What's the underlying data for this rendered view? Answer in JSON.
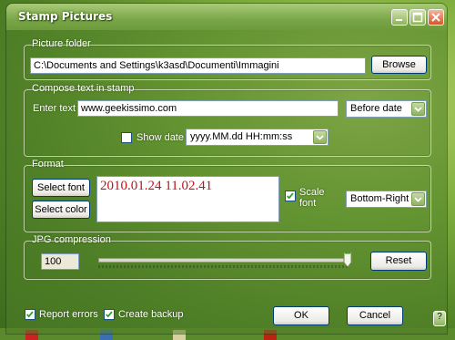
{
  "window": {
    "title": "Stamp Pictures"
  },
  "picture_folder": {
    "legend": "Picture folder",
    "path": "C:\\Documents and Settings\\k3asd\\Documenti\\Immagini",
    "browse_label": "Browse"
  },
  "compose": {
    "legend": "Compose text in stamp",
    "enter_text_label": "Enter text",
    "text_value": "www.geekissimo.com",
    "position_selected": "Before date",
    "show_date_label": "Show date",
    "show_date_checked": false,
    "date_format": "yyyy.MM.dd HH:mm:ss"
  },
  "format": {
    "legend": "Format",
    "select_font_label": "Select font",
    "select_color_label": "Select color",
    "preview_text": "2010.01.24 11.02.41",
    "preview_color": "#c0101a",
    "scale_font_label": "Scale font",
    "scale_font_checked": true,
    "placement_selected": "Bottom-Right"
  },
  "jpg": {
    "legend": "JPG compression",
    "quality_value": "100",
    "slider_level": 1.0,
    "reset_label": "Reset"
  },
  "footer": {
    "report_errors_label": "Report errors",
    "report_errors_checked": true,
    "create_backup_label": "Create backup",
    "create_backup_checked": true,
    "ok_label": "OK",
    "cancel_label": "Cancel",
    "help_label": "?"
  },
  "colors": {
    "title_bar": "#7aa748",
    "accent_border": "#003c74"
  }
}
